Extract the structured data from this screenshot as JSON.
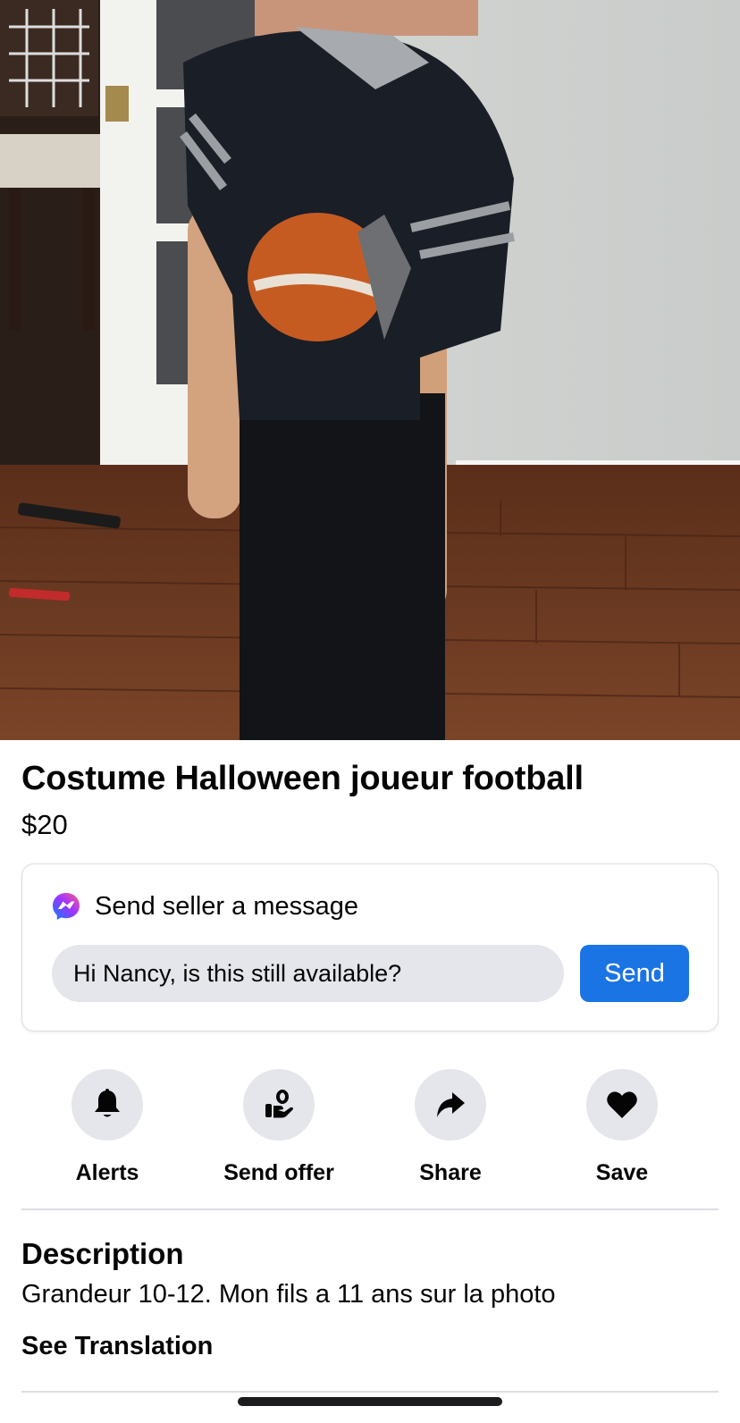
{
  "listing": {
    "title": "Costume Halloween joueur football",
    "price": "$20"
  },
  "message": {
    "header": "Send seller a message",
    "header_icon": "messenger-icon",
    "input_value": "Hi Nancy, is this still available?",
    "send_label": "Send",
    "accent_color": "#1b74e4"
  },
  "actions": [
    {
      "label": "Alerts",
      "icon": "bell-icon"
    },
    {
      "label": "Send offer",
      "icon": "offer-hand-icon"
    },
    {
      "label": "Share",
      "icon": "share-arrow-icon"
    },
    {
      "label": "Save",
      "icon": "heart-icon"
    }
  ],
  "description": {
    "heading": "Description",
    "text": "Grandeur 10-12. Mon fils a 11 ans sur la photo",
    "see_translation": "See Translation"
  }
}
